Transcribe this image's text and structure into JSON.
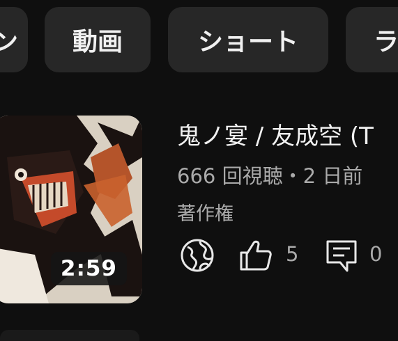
{
  "chips": [
    {
      "label": "ン"
    },
    {
      "label": "動画"
    },
    {
      "label": "ショート"
    },
    {
      "label": "ラ"
    }
  ],
  "video": {
    "title": "鬼ノ宴 / 友成空 (T",
    "meta": "666 回視聴・2 日前",
    "license": "著作権",
    "duration": "2:59",
    "like_count": "5",
    "comment_count": "0"
  },
  "icons": {
    "visibility": "globe-icon",
    "like": "thumbs-up-icon",
    "comment": "comment-icon"
  },
  "colors": {
    "background": "#0f0f0f",
    "chip": "#272727",
    "text": "#f1f1f1",
    "secondary_text": "#aaaaaa"
  }
}
